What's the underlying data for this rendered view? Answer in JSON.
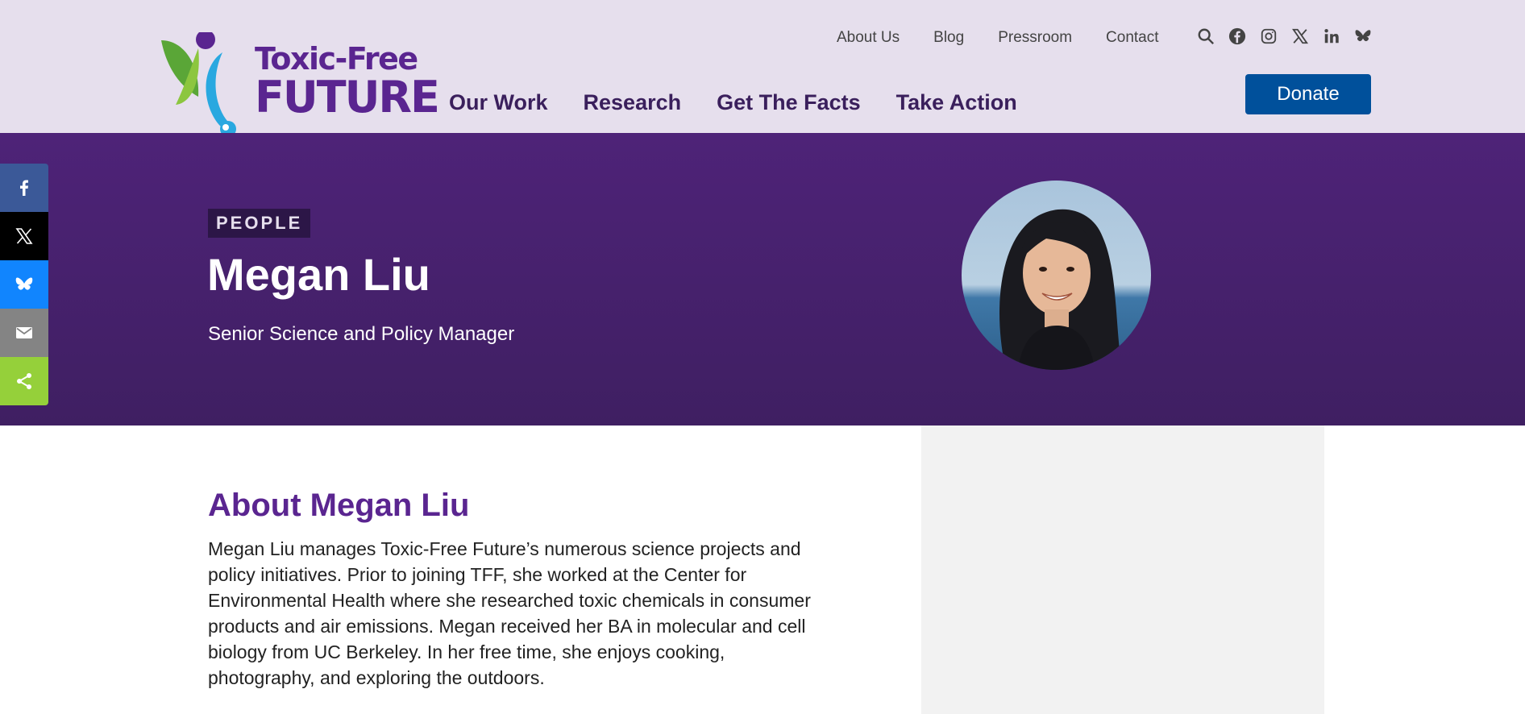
{
  "logo": {
    "line1": "Toxic-Free",
    "line2": "FUTURE"
  },
  "top_links": [
    "About Us",
    "Blog",
    "Pressroom",
    "Contact"
  ],
  "header_icons": [
    "search-icon",
    "facebook-icon",
    "instagram-icon",
    "x-icon",
    "linkedin-icon",
    "bluesky-icon"
  ],
  "main_nav": [
    "Our Work",
    "Research",
    "Get The Facts",
    "Take Action"
  ],
  "donate_label": "Donate",
  "hero": {
    "badge": "PEOPLE",
    "name": "Megan Liu",
    "title": "Senior Science and Policy Manager"
  },
  "share_buttons": [
    {
      "icon": "facebook-icon",
      "color": "#3b5998"
    },
    {
      "icon": "x-icon",
      "color": "#000000"
    },
    {
      "icon": "bluesky-icon",
      "color": "#1185fe"
    },
    {
      "icon": "email-icon",
      "color": "#848484"
    },
    {
      "icon": "share-icon",
      "color": "#95d03a"
    }
  ],
  "about": {
    "heading": "About Megan Liu",
    "body": "Megan Liu manages Toxic-Free Future’s numerous science projects and policy initiatives. Prior to joining TFF, she worked at the Center for Environmental Health where she researched toxic chemicals in consumer products and air emissions. Megan received her BA in molecular and cell biology from UC Berkeley. In her free time, she enjoys cooking, photography, and exploring the outdoors."
  },
  "colors": {
    "header_bg": "#e6dfed",
    "brand_purple": "#5a2590",
    "hero_bg": "#4a2270",
    "donate_bg": "#00509b"
  }
}
